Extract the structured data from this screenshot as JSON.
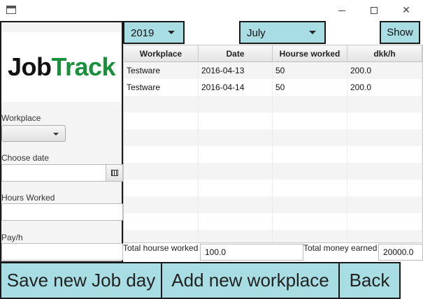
{
  "window": {
    "minimize_icon": "minimize-icon",
    "maximize_icon": "maximize-icon",
    "close_icon": "close-icon"
  },
  "logo": {
    "part1": "Job",
    "part2": "Track",
    "color_dark": "#111111",
    "color_green": "#1a8f3c"
  },
  "form": {
    "workplace_label": "Workplace",
    "workplace_value": "",
    "date_label": "Choose date",
    "date_value": "",
    "hours_label": "Hours Worked",
    "hours_value": "",
    "pay_label": "Pay/h",
    "pay_value": ""
  },
  "filters": {
    "year": "2019",
    "month": "July",
    "show_label": "Show"
  },
  "table": {
    "columns": [
      "Workplace",
      "Date",
      "Hourse worked",
      "dkk/h"
    ],
    "rows": [
      [
        "Testware",
        "2016-04-13",
        "50",
        "200.0"
      ],
      [
        "Testware",
        "2016-04-14",
        "50",
        "200.0"
      ],
      [
        "",
        "",
        "",
        ""
      ],
      [
        "",
        "",
        "",
        ""
      ],
      [
        "",
        "",
        "",
        ""
      ],
      [
        "",
        "",
        "",
        ""
      ],
      [
        "",
        "",
        "",
        ""
      ],
      [
        "",
        "",
        "",
        ""
      ],
      [
        "",
        "",
        "",
        ""
      ],
      [
        "",
        "",
        "",
        ""
      ],
      [
        "",
        "",
        "",
        ""
      ]
    ]
  },
  "totals": {
    "hours_label": "Total hourse worked",
    "hours_value": "100.0",
    "money_label": "Total money earned",
    "money_value": "20000.0"
  },
  "actions": {
    "save_label": "Save new Job day",
    "add_label": "Add new workplace",
    "back_label": "Back"
  },
  "colors": {
    "accent": "#a8dde4",
    "border": "#1a1a1a"
  }
}
